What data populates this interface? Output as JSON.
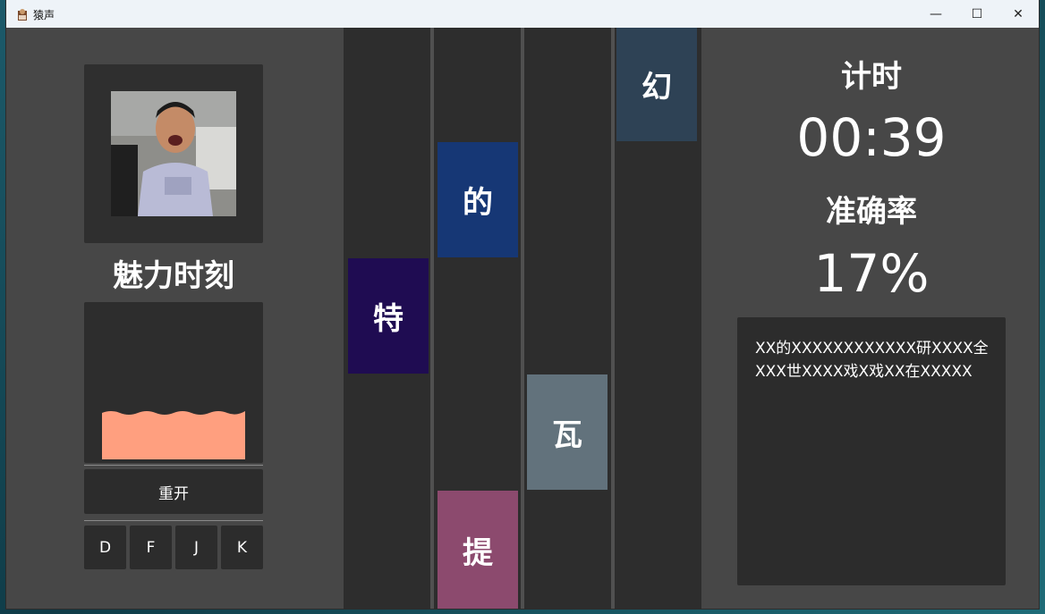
{
  "window": {
    "title": "猿声",
    "minimize_glyph": "—",
    "maximize_glyph": "☐",
    "close_glyph": "✕"
  },
  "player": {
    "avatar_icon": "person-photo",
    "song_title": "魅力时刻",
    "restart_label": "重开",
    "keys": [
      "D",
      "F",
      "J",
      "K"
    ]
  },
  "lanes": [
    {
      "notes": [
        {
          "char": "特",
          "color": "#1f0c52"
        }
      ]
    },
    {
      "notes": [
        {
          "char": "的",
          "color": "#163775"
        },
        {
          "char": "提",
          "color": "#8c4a6e"
        }
      ]
    },
    {
      "notes": [
        {
          "char": "瓦",
          "color": "#62727c"
        }
      ]
    },
    {
      "notes": [
        {
          "char": "幻",
          "color": "#2e4255"
        }
      ]
    }
  ],
  "stats": {
    "timer_label": "计时",
    "timer_value": "00:39",
    "accuracy_label": "准确率",
    "accuracy_value": "17%"
  },
  "lyrics_text": "XX的XXXXXXXXXXXX研XXXX全XXX世XXXX戏X戏XX在XXXXX",
  "colors": {
    "panel_bg": "#474747",
    "lane_bg": "#2d2d2d",
    "wave": "#ff9f7f"
  }
}
